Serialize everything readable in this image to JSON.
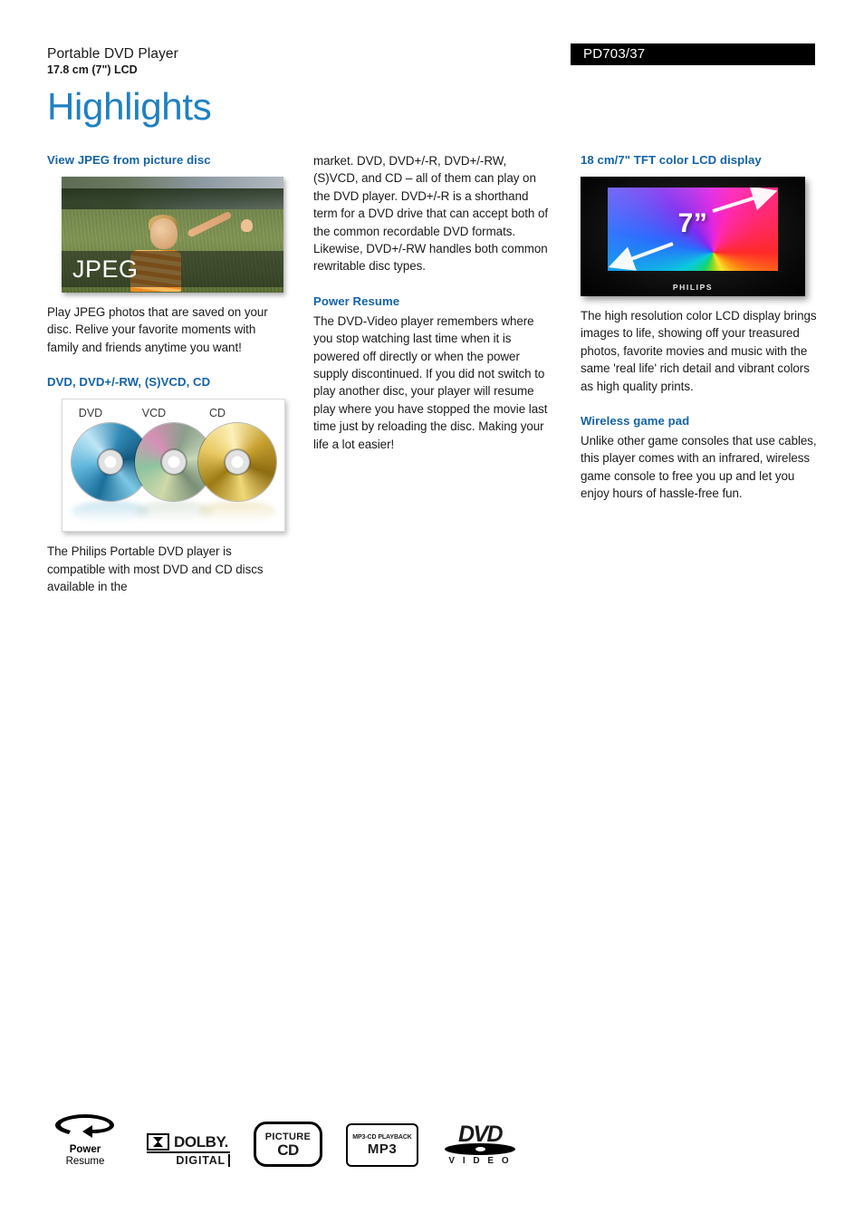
{
  "header": {
    "product_name": "Portable DVD Player",
    "product_sub": "17.8 cm (7\") LCD",
    "model": "PD703/37",
    "page_title": "Highlights"
  },
  "colors": {
    "title_blue": "#2080c0",
    "heading_blue": "#1463a8",
    "badge_bg": "#000000",
    "badge_text": "#ffffff"
  },
  "columns": {
    "left": {
      "sections": [
        {
          "heading": "View JPEG from picture disc",
          "image_caption": "JPEG",
          "body": "Play JPEG photos that are saved on your disc. Relive your favorite moments with family and friends anytime you want!"
        },
        {
          "heading": "DVD, DVD+/-RW, (S)VCD, CD",
          "disc_labels": [
            "DVD",
            "VCD",
            "CD"
          ],
          "body": "The Philips Portable DVD player is compatible with most DVD and CD discs available in the"
        }
      ]
    },
    "middle": {
      "continuation": "market. DVD, DVD+/-R, DVD+/-RW, (S)VCD, and CD – all of them can play on the DVD player. DVD+/-R is a shorthand term for a DVD drive that can accept both of the common recordable DVD formats. Likewise, DVD+/-RW handles both common rewritable disc types.",
      "sections": [
        {
          "heading": "Power Resume",
          "body": "The DVD-Video player remembers where you stop watching last time when it is powered off directly or when the power supply discontinued. If you did not switch to play another disc, your player will resume play where you have stopped the movie last time just by reloading the disc. Making your life a lot easier!"
        }
      ]
    },
    "right": {
      "sections": [
        {
          "heading": "18 cm/7\" TFT color LCD display",
          "screen_label": "7”",
          "brand_mark": "PHILIPS",
          "body": "The high resolution color LCD display brings images to life, showing off your treasured photos, favorite movies and music with the same 'real life' rich detail and vibrant colors as high quality prints."
        },
        {
          "heading": "Wireless game pad",
          "body": "Unlike other game consoles that use cables, this player comes with an infrared, wireless game console to free you up and let you enjoy hours of hassle-free fun."
        }
      ]
    }
  },
  "footer_logos": [
    {
      "name": "power-resume",
      "line1": "Power",
      "line2": "Resume"
    },
    {
      "name": "dolby-digital",
      "line1": "DOLBY.",
      "line2": "DIGITAL"
    },
    {
      "name": "picture-cd",
      "line1": "PICTURE",
      "line2": "CD"
    },
    {
      "name": "mp3-cd-playback",
      "line1": "MP3-CD PLAYBACK",
      "line2": "MP3"
    },
    {
      "name": "dvd-video",
      "line1": "DVD",
      "line2": "V I D E O"
    }
  ]
}
